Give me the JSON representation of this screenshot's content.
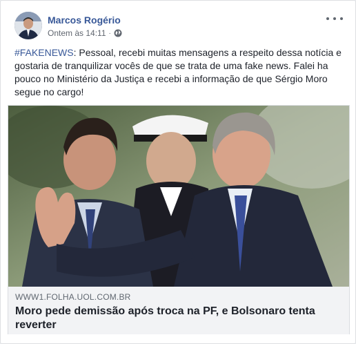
{
  "post": {
    "author": "Marcos Rogério",
    "timestamp": "Ontem às 14:11",
    "separator": "·",
    "privacy_icon": "globe-icon",
    "hashtag": "#FAKENEWS",
    "text_body": ": Pessoal, recebi muitas mensagens a respeito dessa notícia e gostaria de tranquilizar vocês de que se trata de uma fake news. Falei ha pouco no Ministério da Justiça e recebi a informação de que Sérgio Moro segue no cargo!"
  },
  "link_preview": {
    "domain": "WWW1.FOLHA.UOL.COM.BR",
    "title": "Moro pede demissão após troca na PF, e Bolsonaro tenta reverter"
  },
  "colors": {
    "link_blue": "#385898",
    "text": "#1d2129",
    "meta_gray": "#616770",
    "preview_bg": "#f2f3f5"
  }
}
